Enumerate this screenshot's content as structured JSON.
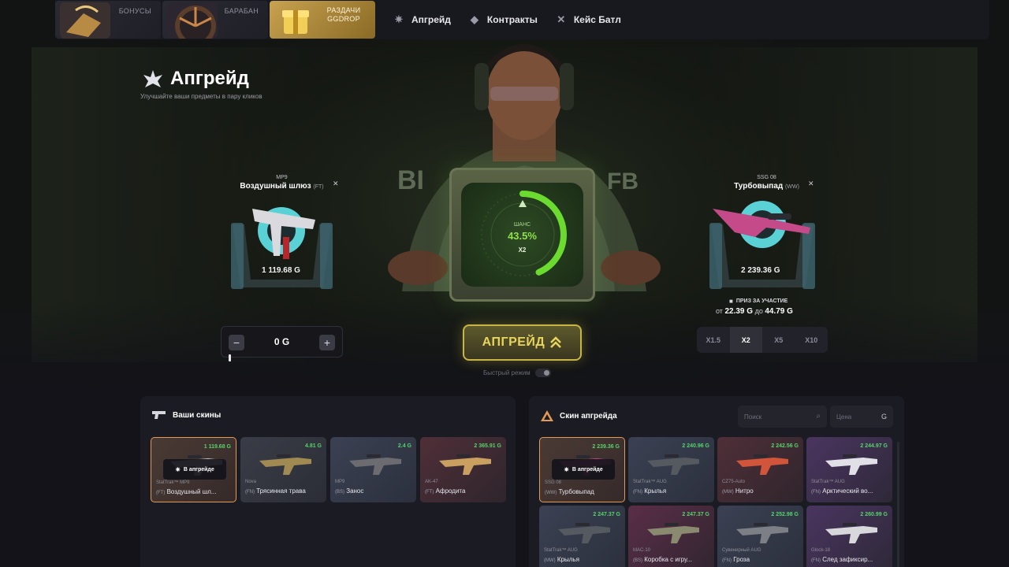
{
  "nav": {
    "promos": [
      {
        "label": "БОНУСЫ"
      },
      {
        "label": "БАРАБАН"
      },
      {
        "label": "РАЗДАЧИ GGDROP"
      }
    ],
    "links": [
      {
        "label": "Апгрейд",
        "icon": "upgrade-icon"
      },
      {
        "label": "Контракты",
        "icon": "contract-icon"
      },
      {
        "label": "Кейс Батл",
        "icon": "battle-icon"
      }
    ]
  },
  "page": {
    "title": "Апгрейд",
    "subtitle": "Улучшайте ваши предметы в пару кликов"
  },
  "source_item": {
    "weapon": "MP9",
    "name": "Воздушный шлюз",
    "wear": "(FT)",
    "price": "1 119.68 G"
  },
  "target_item": {
    "weapon": "SSG 08",
    "name": "Турбовыпад",
    "wear": "(WW)",
    "price": "2 239.36 G"
  },
  "chance": {
    "label": "ШАНС",
    "value": "43.5%",
    "multiplier": "X2",
    "fraction": 0.435
  },
  "prize": {
    "title": "ПРИЗ ЗА УЧАСТИЕ",
    "from_label": "от",
    "from": "22.39 G",
    "to_label": "до",
    "to": "44.79 G"
  },
  "stepper": {
    "minus": "−",
    "plus": "+",
    "value": "0 G"
  },
  "upgrade_button": {
    "label": "АПГРЕЙД"
  },
  "fast_mode": {
    "label": "Быстрый режим"
  },
  "multipliers": [
    {
      "label": "X1.5",
      "active": false
    },
    {
      "label": "X2",
      "active": true
    },
    {
      "label": "X5",
      "active": false
    },
    {
      "label": "X10",
      "active": false
    }
  ],
  "your_skins": {
    "title": "Ваши скины",
    "in_upgrade_label": "В апгрейде",
    "items": [
      {
        "price": "1 119.68 G",
        "weapon": "StatTrak™ MP9",
        "wear": "(FT)",
        "skin": "Воздушный шл...",
        "bg": "bg-sel",
        "selected": true,
        "gun": "#c8c8cc"
      },
      {
        "price": "4.81 G",
        "weapon": "Nova",
        "wear": "(FN)",
        "skin": "Трясинная трава",
        "bg": "bg-grey",
        "selected": false,
        "gun": "#a08a52"
      },
      {
        "price": "2.4 G",
        "weapon": "MP9",
        "wear": "(BS)",
        "skin": "Занос",
        "bg": "bg-blue",
        "selected": false,
        "gun": "#6b6b70"
      },
      {
        "price": "2 365.91 G",
        "weapon": "AK-47",
        "wear": "(FT)",
        "skin": "Афродита",
        "bg": "bg-red",
        "selected": false,
        "gun": "#c9a060"
      }
    ]
  },
  "upgrade_skins": {
    "title": "Скин апгрейда",
    "search_placeholder": "Поиск",
    "sort_label": "Цена",
    "sort_icon": "G",
    "in_upgrade_label": "В апгрейде",
    "items": [
      {
        "price": "2 239.36 G",
        "weapon": "SSG 08",
        "wear": "(WW)",
        "skin": "Турбовыпад",
        "bg": "bg-sel",
        "selected": true,
        "gun": "#c44a8a"
      },
      {
        "price": "2 240.96 G",
        "weapon": "StatTrak™ AUG",
        "wear": "(FN)",
        "skin": "Крылья",
        "bg": "bg-blue",
        "selected": false,
        "gun": "#555a60"
      },
      {
        "price": "2 242.56 G",
        "weapon": "CZ75-Auto",
        "wear": "(MW)",
        "skin": "Нитро",
        "bg": "bg-red",
        "selected": false,
        "gun": "#d0553a"
      },
      {
        "price": "2 244.97 G",
        "weapon": "StatTrak™ AUG",
        "wear": "(FN)",
        "skin": "Арктический во...",
        "bg": "bg-purple",
        "selected": false,
        "gun": "#e0e0e6"
      },
      {
        "price": "2 247.37 G",
        "weapon": "StatTrak™ AUG",
        "wear": "(MW)",
        "skin": "Крылья",
        "bg": "bg-blue",
        "selected": false,
        "gun": "#555a60"
      },
      {
        "price": "2 247.37 G",
        "weapon": "MAC-10",
        "wear": "(BS)",
        "skin": "Коробка с игру...",
        "bg": "bg-pink",
        "selected": false,
        "gun": "#8a8a70"
      },
      {
        "price": "2 252.98 G",
        "weapon": "Сувенирный AUG",
        "wear": "(FN)",
        "skin": "Гроза",
        "bg": "bg-blue",
        "selected": false,
        "gun": "#7c7f86"
      },
      {
        "price": "2 260.99 G",
        "weapon": "Glock-18",
        "wear": "(FN)",
        "skin": "След зафиксир...",
        "bg": "bg-purple",
        "selected": false,
        "gun": "#d8d8dc"
      }
    ]
  },
  "colors": {
    "accent_green": "#54d36a",
    "chance_green": "#6bdc2f",
    "button_gold": "#e7d55d",
    "selected_border": "#e39a54"
  }
}
